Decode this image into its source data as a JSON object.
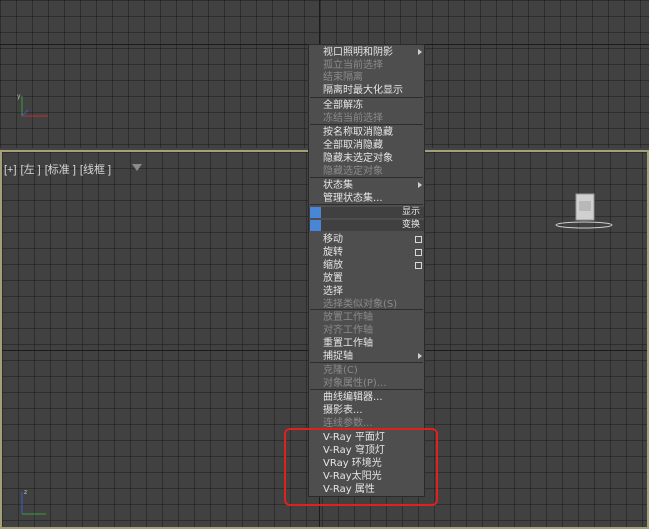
{
  "viewport_top": {},
  "viewport_bottom": {
    "label_parts": [
      "[+]",
      "[左 ]",
      "[标准 ]",
      "[线框 ]"
    ]
  },
  "menu": {
    "items": [
      {
        "label": "视口照明和阴影",
        "disabled": false,
        "submenu": true
      },
      {
        "label": "孤立当前选择",
        "disabled": true
      },
      {
        "label": "结束隔离",
        "disabled": true
      },
      {
        "label": "隔离时最大化显示",
        "disabled": false
      },
      {
        "label": "全部解冻",
        "disabled": false
      },
      {
        "label": "冻结当前选择",
        "disabled": true
      },
      {
        "label": "按名称取消隐藏",
        "disabled": false
      },
      {
        "label": "全部取消隐藏",
        "disabled": false
      },
      {
        "label": "隐藏未选定对象",
        "disabled": false
      },
      {
        "label": "隐藏选定对象",
        "disabled": true
      },
      {
        "label": "状态集",
        "disabled": false,
        "submenu": true
      },
      {
        "label": "管理状态集...",
        "disabled": false
      },
      {
        "label": "移动",
        "disabled": false,
        "box": true
      },
      {
        "label": "旋转",
        "disabled": false,
        "box": true
      },
      {
        "label": "缩放",
        "disabled": false,
        "box": true
      },
      {
        "label": "放置",
        "disabled": false
      },
      {
        "label": "选择",
        "disabled": false
      },
      {
        "label": "选择类似对象(S)",
        "disabled": true
      },
      {
        "label": "放置工作轴",
        "disabled": true
      },
      {
        "label": "对齐工作轴",
        "disabled": true
      },
      {
        "label": "重置工作轴",
        "disabled": false
      },
      {
        "label": "捕捉轴",
        "disabled": false,
        "submenu": true
      },
      {
        "label": "克隆(C)",
        "disabled": true
      },
      {
        "label": "对象属性(P)...",
        "disabled": true
      },
      {
        "label": "曲线编辑器...",
        "disabled": false
      },
      {
        "label": "摄影表...",
        "disabled": false
      },
      {
        "label": "连线参数...",
        "disabled": true
      },
      {
        "label": "V-Ray 平面灯",
        "disabled": false
      },
      {
        "label": "V-Ray 穹顶灯",
        "disabled": false
      },
      {
        "label": "VRay 环境光",
        "disabled": false
      },
      {
        "label": "V-Ray太阳光",
        "disabled": false
      },
      {
        "label": "V-Ray 属性",
        "disabled": false
      }
    ],
    "quad_labels": [
      "显示",
      "变换"
    ]
  },
  "colors": {
    "highlight": "#e01f1f",
    "quad_accent": "#4a86d8",
    "viewport_active_border": "#a6a07a"
  }
}
